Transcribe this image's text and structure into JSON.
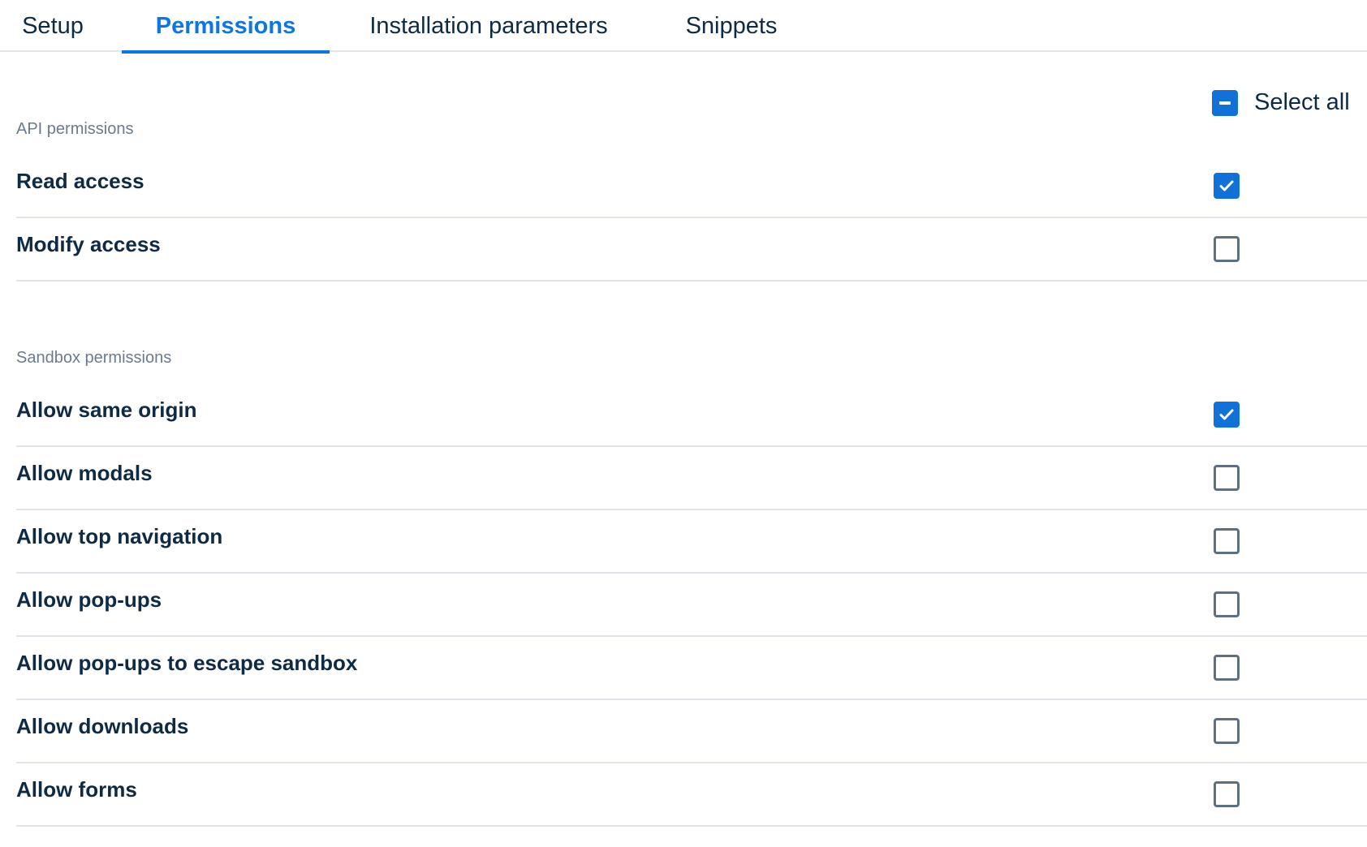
{
  "tabs": [
    {
      "label": "Setup",
      "active": false
    },
    {
      "label": "Permissions",
      "active": true
    },
    {
      "label": "Installation parameters",
      "active": false
    },
    {
      "label": "Snippets",
      "active": false
    }
  ],
  "select_all": {
    "label": "Select all",
    "state": "indeterminate"
  },
  "api_permissions": {
    "title": "API permissions",
    "items": [
      {
        "label": "Read access",
        "checked": true
      },
      {
        "label": "Modify access",
        "checked": false
      }
    ]
  },
  "sandbox_permissions": {
    "title": "Sandbox permissions",
    "items": [
      {
        "label": "Allow same origin",
        "checked": true
      },
      {
        "label": "Allow modals",
        "checked": false
      },
      {
        "label": "Allow top navigation",
        "checked": false
      },
      {
        "label": "Allow pop-ups",
        "checked": false
      },
      {
        "label": "Allow pop-ups to escape sandbox",
        "checked": false
      },
      {
        "label": "Allow downloads",
        "checked": false
      },
      {
        "label": "Allow forms",
        "checked": false
      }
    ]
  },
  "colors": {
    "accent": "#0e76e0",
    "checkbox_checked": "#1271d6",
    "text": "#0f2a44",
    "muted": "#6b7b8c",
    "divider": "#dfe4ea"
  }
}
